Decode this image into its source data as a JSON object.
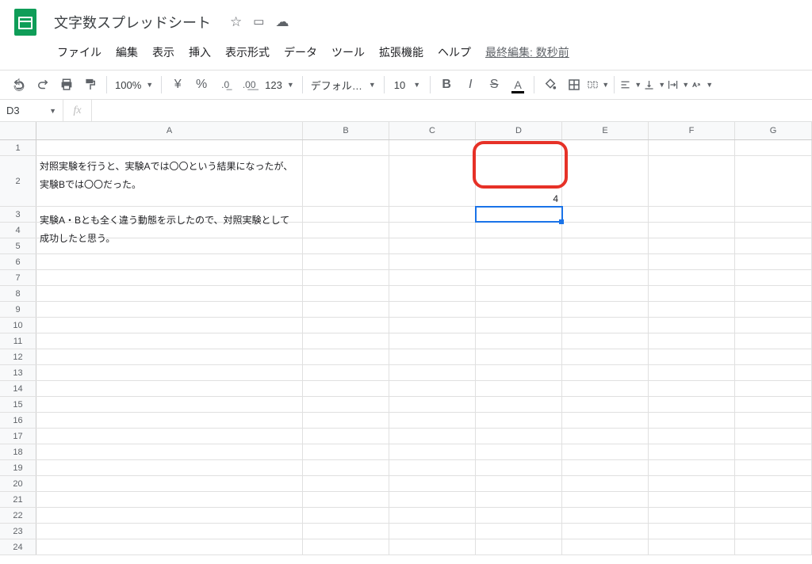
{
  "doc": {
    "title": "文字数スプレッドシート"
  },
  "menubar": {
    "items": [
      "ファイル",
      "編集",
      "表示",
      "挿入",
      "表示形式",
      "データ",
      "ツール",
      "拡張機能",
      "ヘルプ"
    ],
    "last_edit": "最終編集: 数秒前"
  },
  "toolbar": {
    "zoom": "100%",
    "currency": "¥",
    "percent": "%",
    "dec_dec": ".0",
    "inc_dec": ".00",
    "num_fmt": "123",
    "font": "デフォルト...",
    "font_size": "10",
    "bold": "B",
    "italic": "I",
    "strike": "S",
    "text_color": "A"
  },
  "namebox": {
    "value": "D3"
  },
  "fx": {
    "label": "fx"
  },
  "columns": [
    "A",
    "B",
    "C",
    "D",
    "E",
    "F",
    "G"
  ],
  "cells": {
    "A2": "対照実験を行うと、実験Aでは〇〇という結果になったが、実験Bでは〇〇だった。\n\n実験A・Bとも全く違う動態を示したので、対照実験として成功したと思う。",
    "D2": "4"
  }
}
